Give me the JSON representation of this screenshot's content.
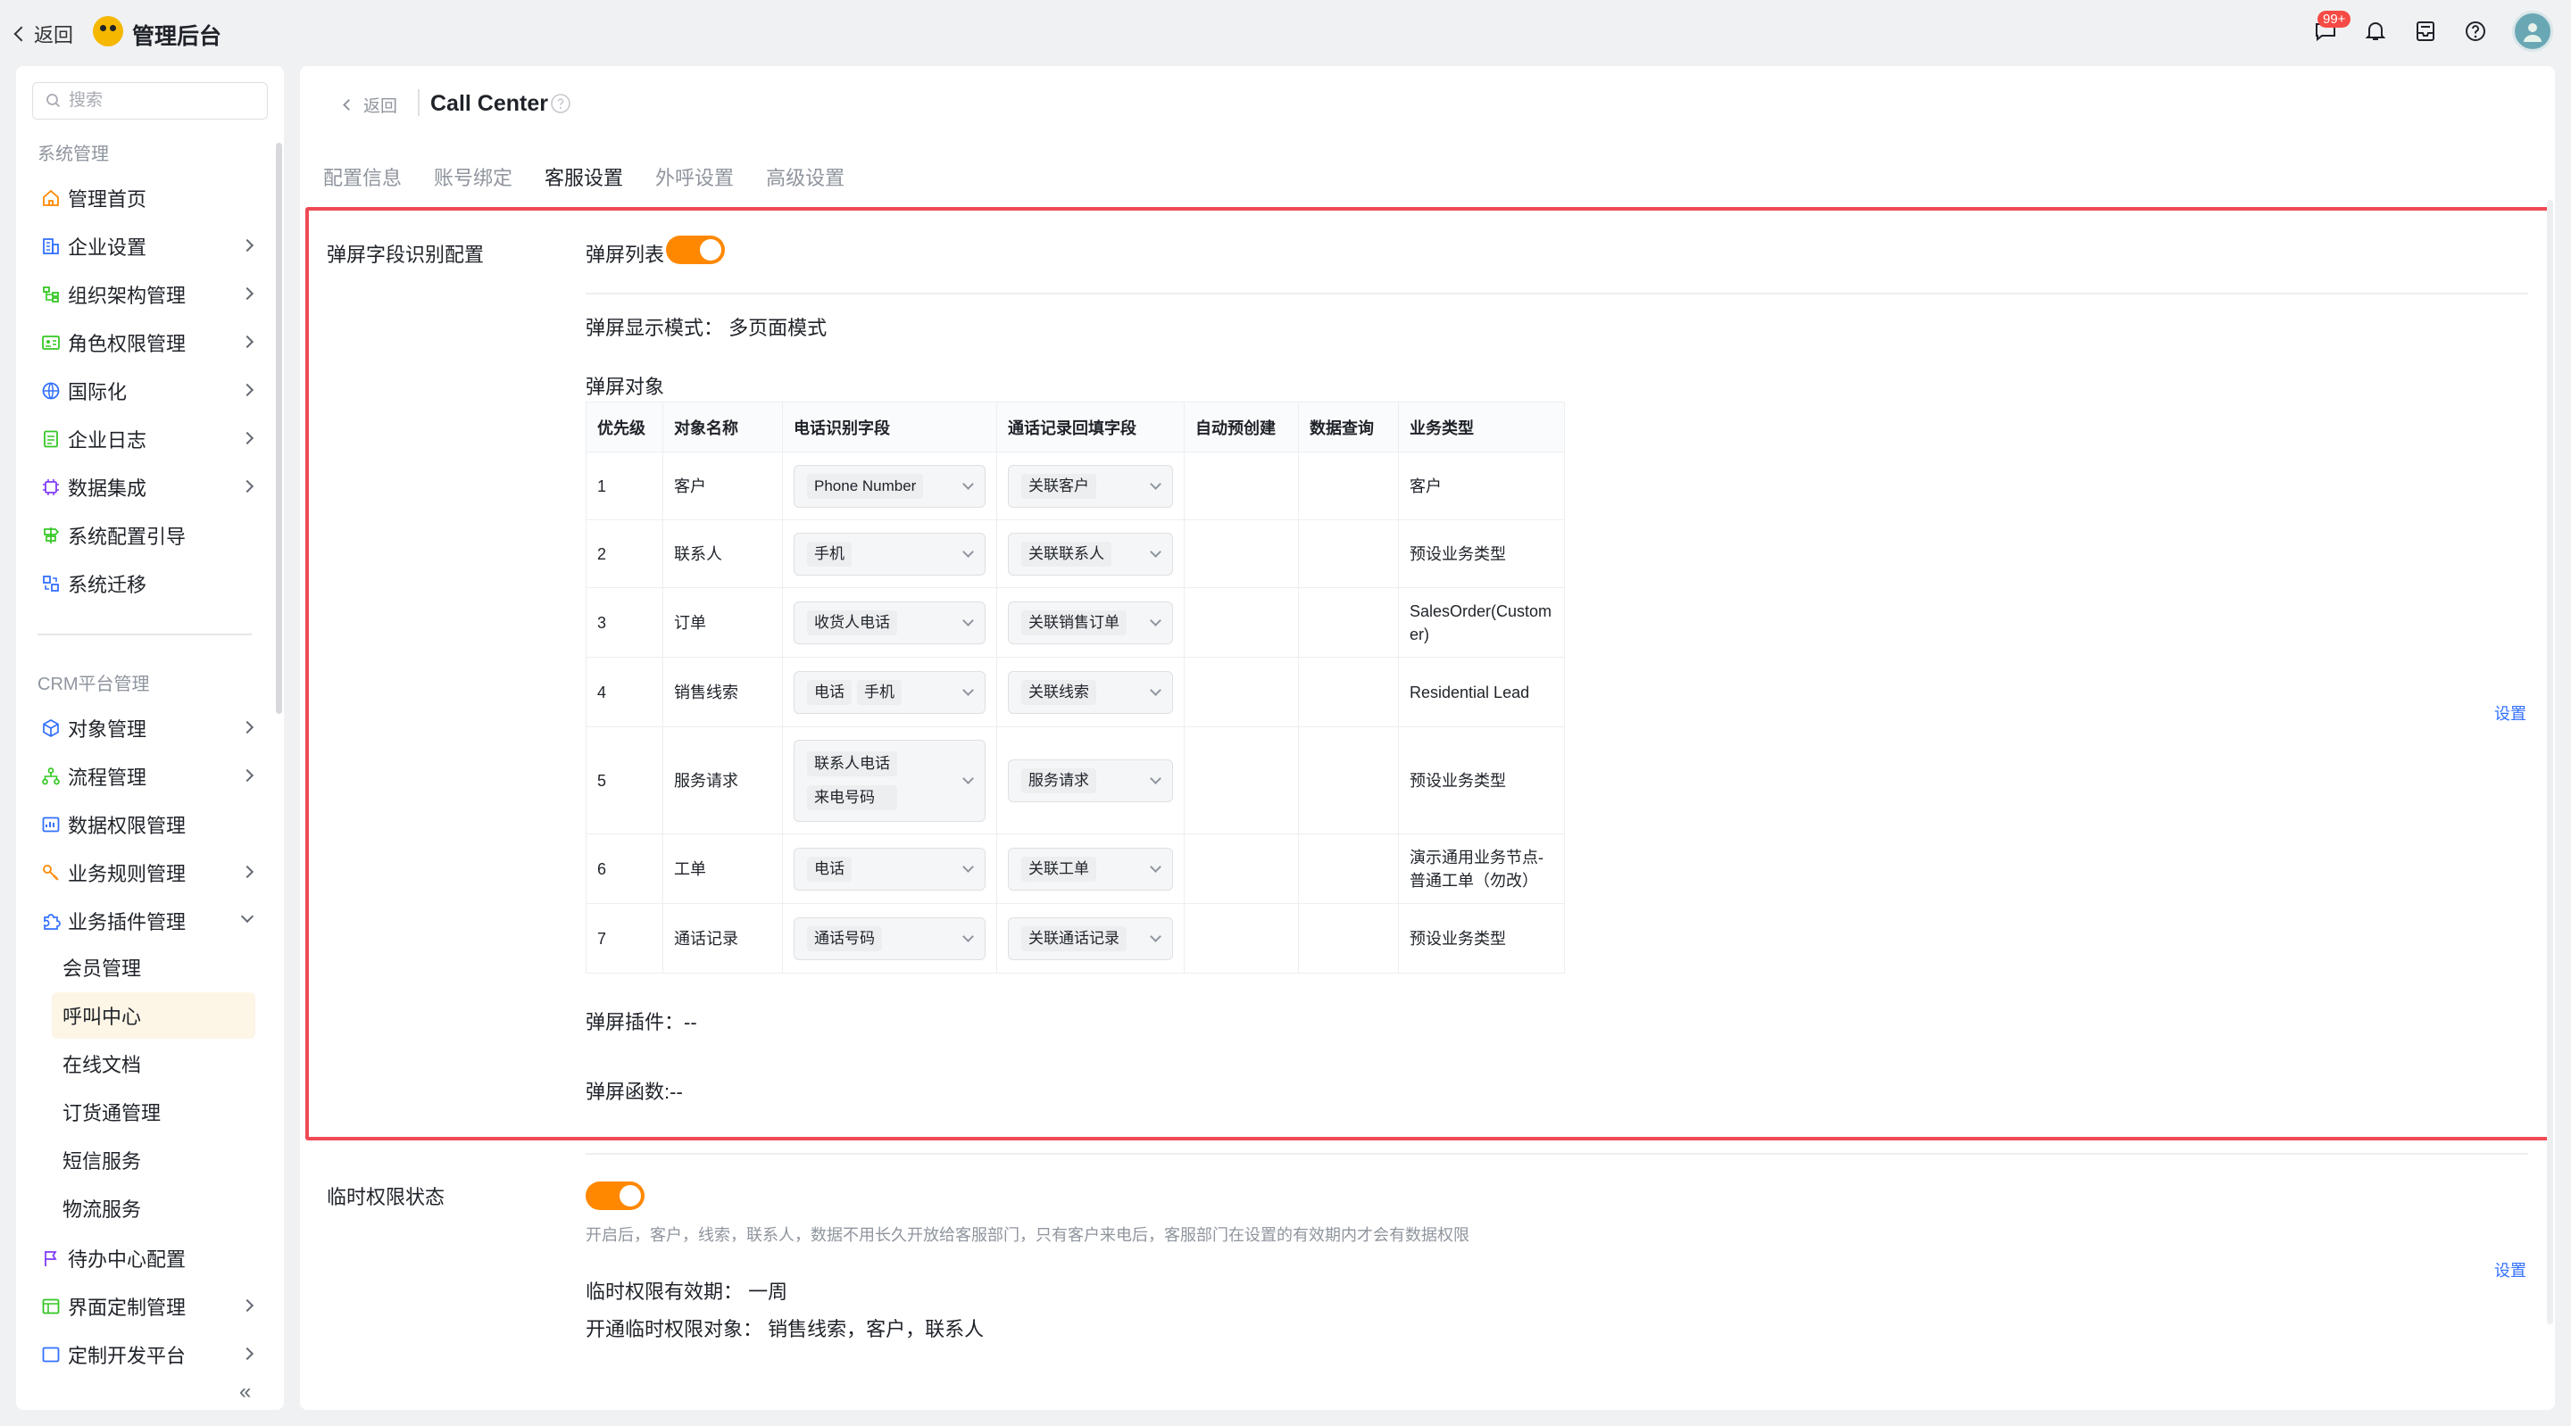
{
  "topbar": {
    "back_label": "返回",
    "app_title": "管理后台",
    "notification_badge": "99+"
  },
  "sidebar": {
    "search_placeholder": "搜索",
    "group_system": "系统管理",
    "system_items": [
      {
        "label": "管理首页",
        "icon": "home-icon"
      },
      {
        "label": "企业设置",
        "icon": "building-icon"
      },
      {
        "label": "组织架构管理",
        "icon": "org-tree-icon"
      },
      {
        "label": "角色权限管理",
        "icon": "role-card-icon"
      },
      {
        "label": "国际化",
        "icon": "globe-icon"
      },
      {
        "label": "企业日志",
        "icon": "log-icon"
      },
      {
        "label": "数据集成",
        "icon": "chip-icon"
      },
      {
        "label": "系统配置引导",
        "icon": "signpost-icon"
      },
      {
        "label": "系统迁移",
        "icon": "migrate-icon"
      }
    ],
    "group_crm": "CRM平台管理",
    "crm_items": [
      {
        "label": "对象管理",
        "icon": "cube-icon"
      },
      {
        "label": "流程管理",
        "icon": "flow-icon"
      },
      {
        "label": "数据权限管理",
        "icon": "data-permission-icon"
      },
      {
        "label": "业务规则管理",
        "icon": "rule-icon"
      },
      {
        "label": "业务插件管理",
        "icon": "plugin-icon"
      }
    ],
    "plugin_subitems": [
      "会员管理",
      "呼叫中心",
      "在线文档",
      "订货通管理",
      "短信服务",
      "物流服务"
    ],
    "more_items": [
      {
        "label": "待办中心配置",
        "icon": "flag-icon"
      },
      {
        "label": "界面定制管理",
        "icon": "layout-icon"
      },
      {
        "label": "定制开发平台",
        "icon": "dev-icon"
      }
    ],
    "collapse_glyph": "«"
  },
  "main": {
    "back_label": "返回",
    "title": "Call Center",
    "tabs": [
      "配置信息",
      "账号绑定",
      "客服设置",
      "外呼设置",
      "高级设置"
    ],
    "active_tab": "客服设置",
    "popup": {
      "section_label": "弹屏字段识别配置",
      "list_label": "弹屏列表",
      "display_mode_label": "弹屏显示模式：",
      "display_mode_value": "多页面模式",
      "objects_label": "弹屏对象",
      "plugin_label": "弹屏插件：",
      "plugin_value": "--",
      "function_label": "弹屏函数:",
      "function_value": "--",
      "setting_link": "设置"
    },
    "table": {
      "headers": [
        "优先级",
        "对象名称",
        "电话识别字段",
        "通话记录回填字段",
        "自动预创建",
        "数据查询",
        "业务类型"
      ],
      "rows": [
        {
          "priority": "1",
          "object": "客户",
          "phone_fields": [
            "Phone Number"
          ],
          "backfill": "关联客户",
          "auto": "",
          "query": "",
          "biz_type": "客户"
        },
        {
          "priority": "2",
          "object": "联系人",
          "phone_fields": [
            "手机"
          ],
          "backfill": "关联联系人",
          "auto": "",
          "query": "",
          "biz_type": "预设业务类型"
        },
        {
          "priority": "3",
          "object": "订单",
          "phone_fields": [
            "收货人电话"
          ],
          "backfill": "关联销售订单",
          "auto": "",
          "query": "",
          "biz_type": "SalesOrder(Customer)"
        },
        {
          "priority": "4",
          "object": "销售线索",
          "phone_fields": [
            "电话",
            "手机"
          ],
          "backfill": "关联线索",
          "auto": "",
          "query": "",
          "biz_type": "Residential Lead"
        },
        {
          "priority": "5",
          "object": "服务请求",
          "phone_fields": [
            "联系人电话",
            "来电号码"
          ],
          "backfill": "服务请求",
          "auto": "",
          "query": "",
          "biz_type": "预设业务类型"
        },
        {
          "priority": "6",
          "object": "工单",
          "phone_fields": [
            "电话"
          ],
          "backfill": "关联工单",
          "auto": "",
          "query": "",
          "biz_type": "演示通用业务节点-普通工单（勿改）"
        },
        {
          "priority": "7",
          "object": "通话记录",
          "phone_fields": [
            "通话号码"
          ],
          "backfill": "关联通话记录",
          "auto": "",
          "query": "",
          "biz_type": "预设业务类型"
        }
      ]
    },
    "temp": {
      "section_label": "临时权限状态",
      "hint": "开启后，客户，线索，联系人，数据不用长久开放给客服部门，只有客户来电后，客服部门在设置的有效期内才会有数据权限",
      "validity_label": "临时权限有效期：",
      "validity_value": "一周",
      "objects_label": "开通临时权限对象：",
      "objects_value": "销售线索，客户，联系人",
      "setting_link": "设置"
    }
  },
  "colors": {
    "accent": "#ff8800",
    "highlight_border": "#f04a55",
    "link": "#3370ff"
  }
}
